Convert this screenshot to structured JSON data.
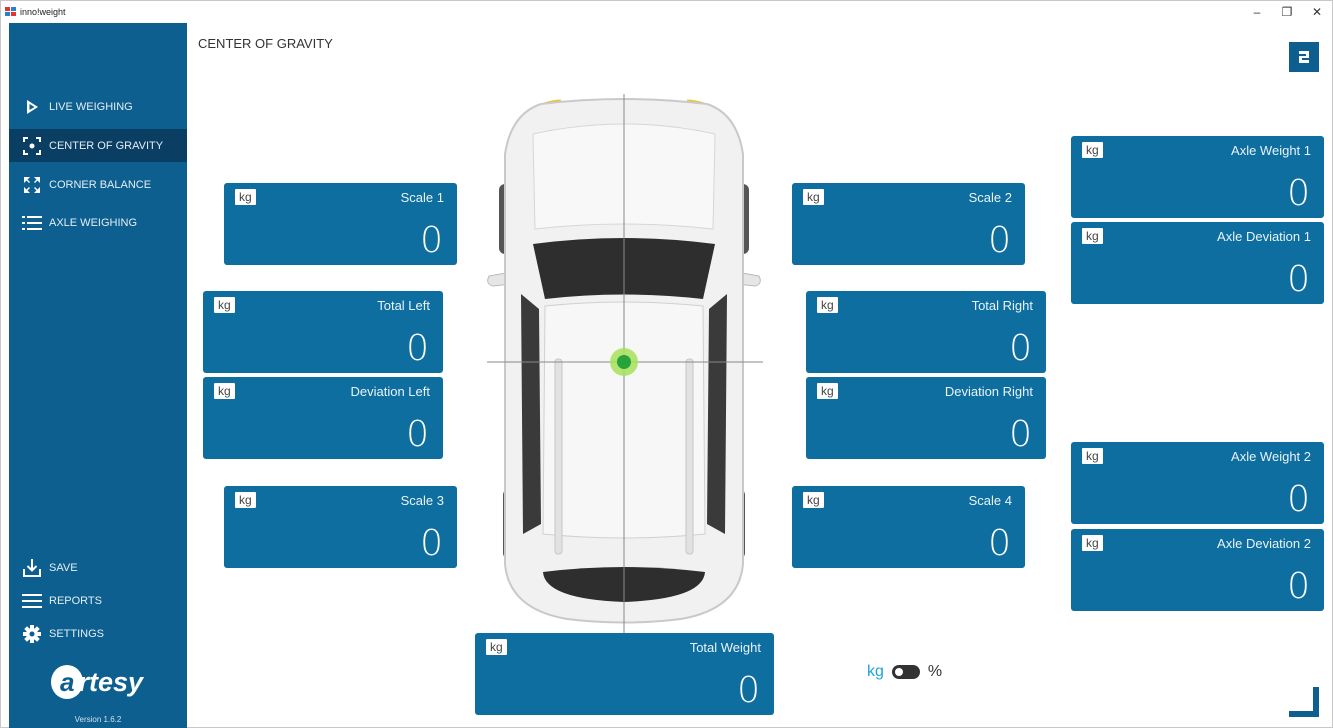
{
  "window": {
    "title": "inno!weight",
    "controls": [
      "–",
      "❐",
      "✕"
    ]
  },
  "colors": {
    "sidebar": "#0d5f8f",
    "sidebar_active": "#0a3f63",
    "card": "#0e6e9f",
    "accent": "#1ea3d9",
    "cog_marker": "#3ab53a"
  },
  "sidebar": {
    "nav": [
      {
        "label": "LIVE WEIGHING",
        "icon": "play-icon",
        "active": false
      },
      {
        "label": "CENTER OF GRAVITY",
        "icon": "target-icon",
        "active": true
      },
      {
        "label": "CORNER BALANCE",
        "icon": "expand-corners-icon",
        "active": false
      },
      {
        "label": "AXLE WEIGHING",
        "icon": "list-icon",
        "active": false
      }
    ],
    "actions": [
      {
        "label": "SAVE",
        "icon": "download-icon"
      },
      {
        "label": "REPORTS",
        "icon": "lines-icon"
      },
      {
        "label": "SETTINGS",
        "icon": "gear-icon"
      }
    ],
    "logo": {
      "mark": "a",
      "text": "rtesy"
    },
    "version": "Version 1.6.2"
  },
  "main": {
    "title": "CENTER OF GRAVITY",
    "badge_icon": "layout-icon",
    "cards": {
      "scale1": {
        "unit": "kg",
        "label": "Scale 1",
        "value": "0"
      },
      "scale2": {
        "unit": "kg",
        "label": "Scale 2",
        "value": "0"
      },
      "scale3": {
        "unit": "kg",
        "label": "Scale 3",
        "value": "0"
      },
      "scale4": {
        "unit": "kg",
        "label": "Scale 4",
        "value": "0"
      },
      "total_left": {
        "unit": "kg",
        "label": "Total Left",
        "value": "0"
      },
      "total_right": {
        "unit": "kg",
        "label": "Total Right",
        "value": "0"
      },
      "deviation_left": {
        "unit": "kg",
        "label": "Deviation Left",
        "value": "0"
      },
      "deviation_right": {
        "unit": "kg",
        "label": "Deviation Right",
        "value": "0"
      },
      "axle_weight1": {
        "unit": "kg",
        "label": "Axle Weight 1",
        "value": "0"
      },
      "axle_deviation1": {
        "unit": "kg",
        "label": "Axle Deviation 1",
        "value": "0"
      },
      "axle_weight2": {
        "unit": "kg",
        "label": "Axle Weight 2",
        "value": "0"
      },
      "axle_deviation2": {
        "unit": "kg",
        "label": "Axle Deviation 2",
        "value": "0"
      },
      "total_weight": {
        "unit": "kg",
        "label": "Total Weight",
        "value": "0"
      }
    },
    "unit_toggle": {
      "left": "kg",
      "right": "%",
      "state": "kg"
    }
  }
}
